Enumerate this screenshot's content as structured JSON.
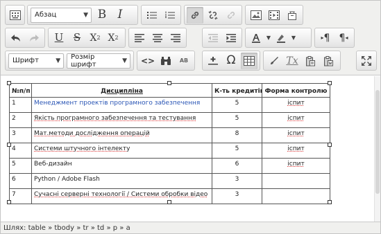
{
  "toolbar": {
    "format_select": "Абзац",
    "font_select": "Шрифт",
    "size_select": "Розмір шрифт",
    "bold": "B",
    "italic": "I",
    "underline": "U",
    "strike": "S",
    "subscript_base": "X",
    "subscript_mark": "2",
    "superscript_base": "X",
    "superscript_mark": "2",
    "omega": "Ω",
    "code": "<>",
    "pilcrow_ltr": "¶",
    "pilcrow_rtl": "¶",
    "clear_format": "Tx",
    "spell_label": "АВ"
  },
  "table": {
    "headers": [
      "№п/п",
      "Дисципліна",
      "К-ть кредитів",
      "Форма контролю"
    ],
    "rows": [
      {
        "num": "1",
        "discipline": "Менеджмент проектів програмного забезпечення",
        "credits": "5",
        "control": "іспит"
      },
      {
        "num": "2",
        "discipline": "Якість програмного забезпечення та тестування",
        "credits": "5",
        "control": "іспит"
      },
      {
        "num": "3",
        "discipline": "Мат.методи дослідження операцій",
        "credits": "8",
        "control": "іспит"
      },
      {
        "num": "4",
        "discipline": "Системи штучного інтелекту",
        "credits": "5",
        "control": "іспит"
      },
      {
        "num": "5",
        "discipline": "Веб-дизайн",
        "credits": "6",
        "control": "іспит"
      },
      {
        "num": "6",
        "discipline": "Python / Adobe Flash",
        "credits": "3",
        "control": ""
      },
      {
        "num": "7",
        "discipline": "Сучасні серверні технології / Системи обробки відео",
        "credits": "3",
        "control": ""
      }
    ]
  },
  "statusbar": {
    "path": "Шлях: table » tbody » tr » td » p » a"
  },
  "colors": {
    "toolbar_bg": "#f0f0ee",
    "link": "#2a55b5",
    "spell_underline": "#d44444"
  }
}
